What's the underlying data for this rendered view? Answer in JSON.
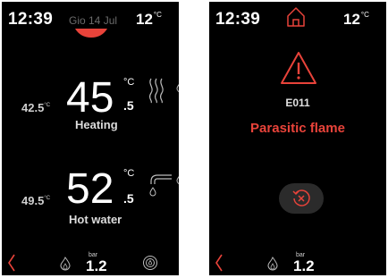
{
  "left_screen": {
    "status": {
      "time": "12:39",
      "date": "Gio 14 Jul",
      "outdoor_temp": "12",
      "outdoor_unit": "°C"
    },
    "heating": {
      "setpoint": "42.5",
      "setpoint_unit": "°C",
      "value_int": "45",
      "value_dec": ".5",
      "unit": "°C",
      "label": "Heating"
    },
    "hot_water": {
      "setpoint": "49.5",
      "setpoint_unit": "°C",
      "value_int": "52",
      "value_dec": ".5",
      "unit": "°C",
      "label": "Hot water"
    },
    "bottom": {
      "pressure_label": "bar",
      "pressure_value": "1.2"
    }
  },
  "right_screen": {
    "status": {
      "time": "12:39",
      "outdoor_temp": "12",
      "outdoor_unit": "°C"
    },
    "error": {
      "code": "E011",
      "message": "Parasitic flame"
    },
    "bottom": {
      "pressure_label": "bar",
      "pressure_value": "1.2"
    }
  },
  "colors": {
    "accent_red": "#e8433a",
    "background": "#000000",
    "button_bg": "#2b2b2b"
  },
  "icons": [
    "chevron-left-icon",
    "flame-icon",
    "home-icon",
    "heating-radiant-icon",
    "faucet-icon",
    "warning-triangle-icon",
    "reset-icon",
    "settings-icon"
  ]
}
